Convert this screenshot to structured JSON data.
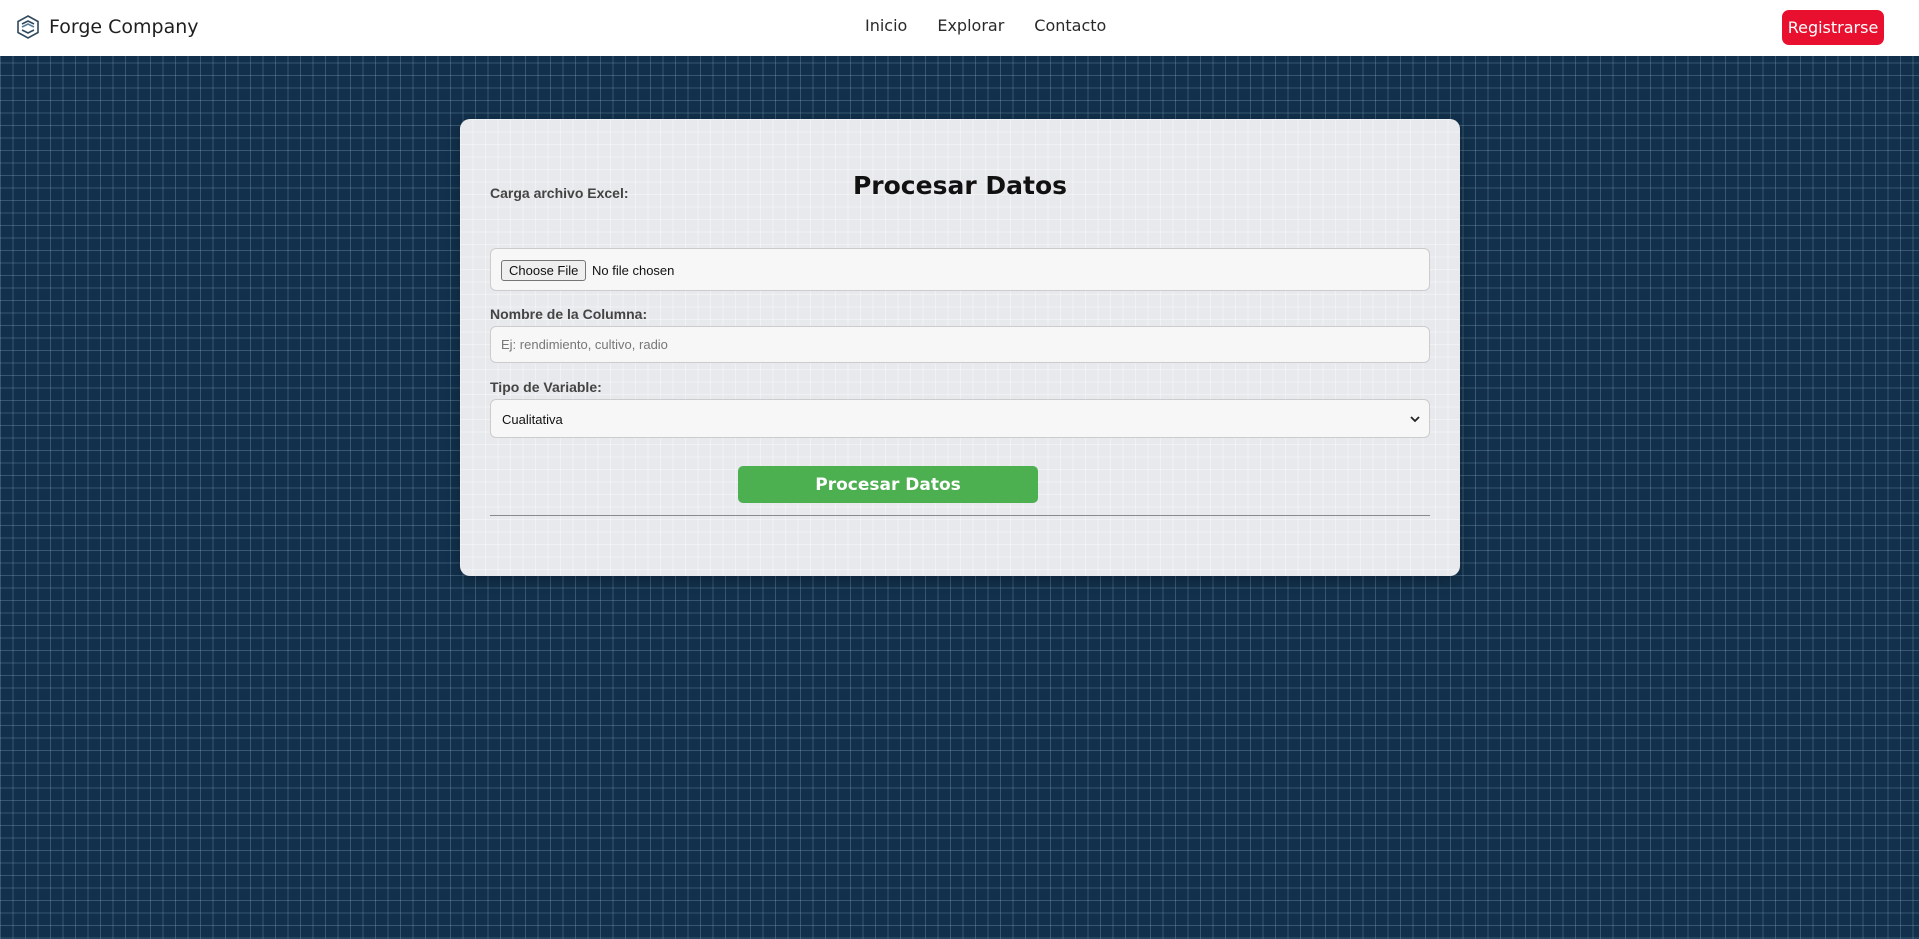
{
  "navbar": {
    "brand": "Forge Company",
    "links": [
      {
        "label": "Inicio"
      },
      {
        "label": "Explorar"
      },
      {
        "label": "Contacto"
      }
    ],
    "register_label": "Registrarse",
    "register_color": "#e8102e"
  },
  "form": {
    "title": "Procesar Datos",
    "file": {
      "label": "Carga archivo Excel:",
      "button_label": "Choose File",
      "status": "No file chosen"
    },
    "column": {
      "label": "Nombre de la Columna:",
      "placeholder": "Ej: rendimiento, cultivo, radio",
      "value": ""
    },
    "variable_type": {
      "label": "Tipo de Variable:",
      "selected": "Cualitativa"
    },
    "submit_label": "Procesar Datos",
    "submit_color": "#4caf50"
  },
  "icons": {
    "logo": "forge-logo-icon",
    "select_arrow": "chevron-down-icon"
  }
}
